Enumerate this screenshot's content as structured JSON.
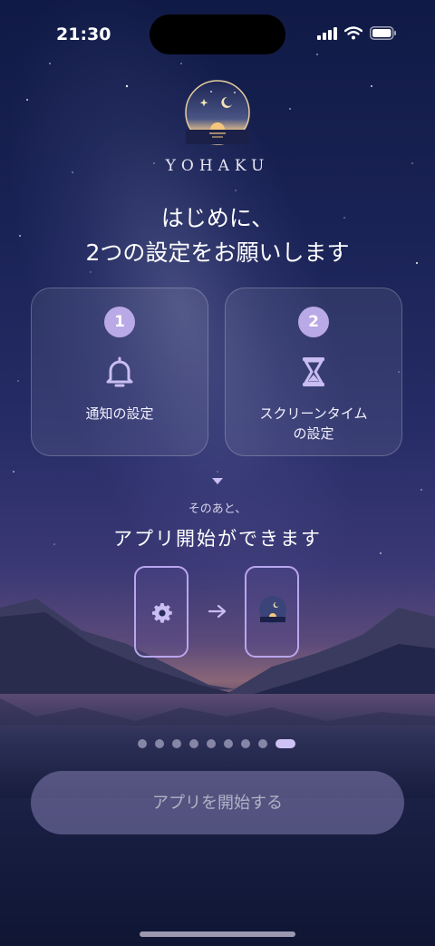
{
  "status": {
    "time": "21:30"
  },
  "brand": {
    "name": "YOHAKU"
  },
  "headline": {
    "line1": "はじめに、",
    "line2": "2つの設定をお願いします"
  },
  "cards": [
    {
      "number": "1",
      "icon": "bell-icon",
      "label_line1": "通知の設定",
      "label_line2": ""
    },
    {
      "number": "2",
      "icon": "hourglass-icon",
      "label_line1": "スクリーンタイム",
      "label_line2": "の設定"
    }
  ],
  "after": {
    "small": "そのあと、",
    "large": "アプリ開始ができます"
  },
  "flow": {
    "from_icon": "gear-icon",
    "arrow_icon": "arrow-right-icon",
    "to_icon": "app-logo-icon"
  },
  "pagination": {
    "total": 9,
    "current": 9
  },
  "cta": {
    "label": "アプリを開始する",
    "enabled": false
  },
  "colors": {
    "accent": "#b9a9e6",
    "active_dot": "#cfc3f6",
    "background_top": "#101a45"
  }
}
